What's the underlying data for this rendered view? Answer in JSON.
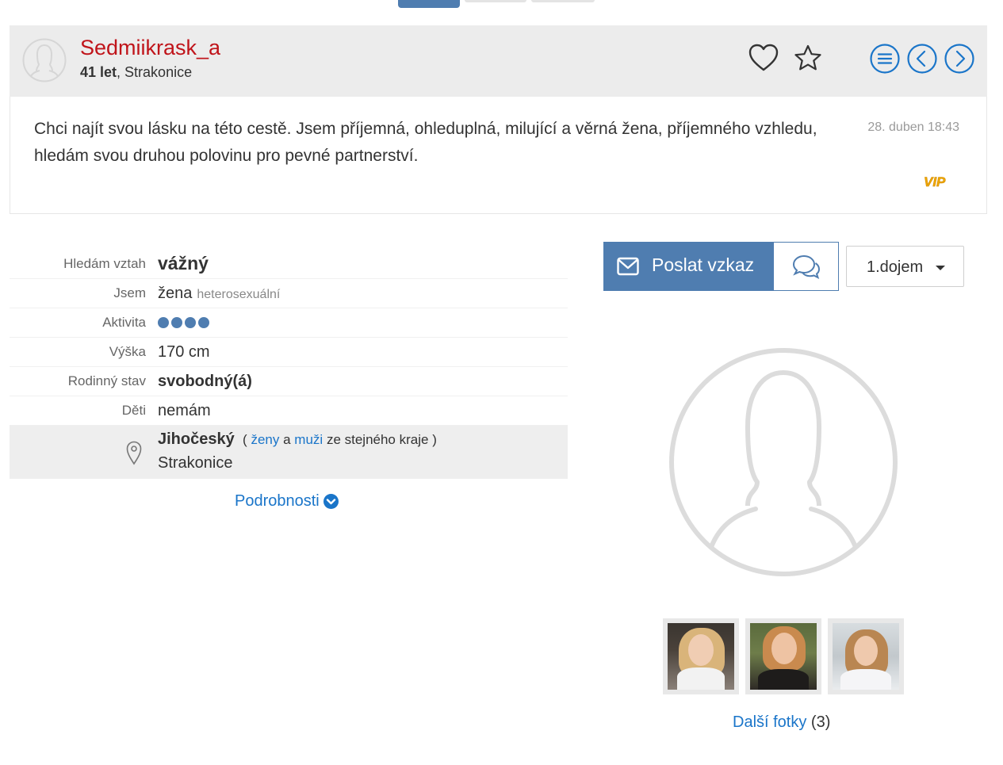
{
  "profile": {
    "username": "Sedmiikrask_a",
    "age": "41 let",
    "city": "Strakonice",
    "intro": "Chci najít svou lásku na této cestě. Jsem příjemná, ohleduplná, milující a věrná žena, příjemného vzhledu, hledám svou druhou polovinu pro pevné partnerství.",
    "date": "28. duben 18:43",
    "badge": "VIP"
  },
  "details": {
    "relationship_label": "Hledám vztah",
    "relationship_value": "vážný",
    "iam_label": "Jsem",
    "iam_value": "žena",
    "iam_sub": "heterosexuální",
    "activity_label": "Aktivita",
    "activity_level": 4,
    "height_label": "Výška",
    "height_value": "170 cm",
    "marital_label": "Rodinný stav",
    "marital_value": "svobodný(á)",
    "kids_label": "Děti",
    "kids_value": "nemám",
    "region": "Jihočeský",
    "region_open": "(",
    "region_women": "ženy",
    "region_and": "a",
    "region_men": "muži",
    "region_suffix": "ze stejného kraje",
    "region_close": ")",
    "town": "Strakonice",
    "more_link": "Podrobnosti"
  },
  "actions": {
    "send_message": "Poslat vzkaz",
    "first_impression": "1.dojem"
  },
  "photos": {
    "more_label": "Další fotky",
    "count": "(3)"
  },
  "colors": {
    "accent": "#4f7db0",
    "username": "#c0141a",
    "link": "#1a75c9",
    "vip": "#f0a800"
  }
}
